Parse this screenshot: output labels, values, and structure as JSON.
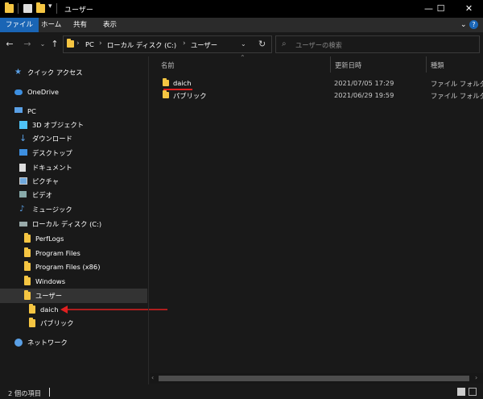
{
  "title": "ユーザー",
  "ribbon": {
    "tabs": [
      "ファイル",
      "ホーム",
      "共有",
      "表示"
    ]
  },
  "address": {
    "crumbs": [
      "PC",
      "ローカル ディスク (C:)",
      "ユーザー"
    ]
  },
  "search": {
    "placeholder": "ユーザーの検索"
  },
  "sidebar": {
    "items": [
      {
        "label": "クイック アクセス"
      },
      {
        "label": "OneDrive"
      },
      {
        "label": "PC"
      },
      {
        "label": "3D オブジェクト"
      },
      {
        "label": "ダウンロード"
      },
      {
        "label": "デスクトップ"
      },
      {
        "label": "ドキュメント"
      },
      {
        "label": "ピクチャ"
      },
      {
        "label": "ビデオ"
      },
      {
        "label": "ミュージック"
      },
      {
        "label": "ローカル ディスク (C:)"
      },
      {
        "label": "PerfLogs"
      },
      {
        "label": "Program Files"
      },
      {
        "label": "Program Files (x86)"
      },
      {
        "label": "Windows"
      },
      {
        "label": "ユーザー"
      },
      {
        "label": "daich"
      },
      {
        "label": "パブリック"
      },
      {
        "label": "ネットワーク"
      }
    ]
  },
  "columns": {
    "name": "名前",
    "date": "更新日時",
    "type": "種類"
  },
  "files": [
    {
      "name": "daich",
      "date": "2021/07/05 17:29",
      "type": "ファイル フォルダー"
    },
    {
      "name": "パブリック",
      "date": "2021/06/29 19:59",
      "type": "ファイル フォルダー"
    }
  ],
  "status": {
    "count": "2 個の項目"
  },
  "colors": {
    "accent": "#1a65b5",
    "annotation": "#e02020",
    "folder": "#f5c542"
  }
}
